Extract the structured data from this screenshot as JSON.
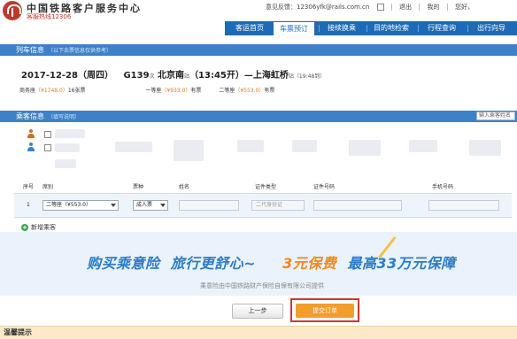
{
  "header": {
    "site_title": "中国铁路客户服务中心",
    "hotline": "客服热线12306",
    "account_label": "意见反馈：",
    "account_email": "12306yfk@rails.com.cn",
    "logout": "退出",
    "my_label": "我的",
    "welcome": "您好，",
    "colors": {
      "brand_red": "#c0392b",
      "nav_blue": "#1d6ab8"
    }
  },
  "nav": {
    "items": [
      "客运首页",
      "车票预订",
      "接续换乘",
      "目的地检索",
      "行程查询",
      "出行向导"
    ],
    "active_index": 1
  },
  "train_info": {
    "bar_title": "列车信息",
    "bar_note": "（以下余票信息仅供参考）",
    "date": "2017-12-28（周四）",
    "train_no": "G139",
    "train_suffix": "次",
    "from": "北京南",
    "from_suffix": "站",
    "depart": "（13:45开）",
    "dash": "—",
    "to": "上海虹桥",
    "to_suffix": "站",
    "arrive": "（19:48到）",
    "seats": [
      {
        "label": "商务座",
        "price": "（¥1748.0）",
        "avail": "16张票"
      },
      {
        "label": "一等座",
        "price": "（¥933.0）",
        "avail": "有票"
      },
      {
        "label": "二等座",
        "price": "（¥553.0）",
        "avail": "有票"
      }
    ]
  },
  "passenger_info": {
    "bar_title": "乘客信息",
    "bar_note": "（填写说明）",
    "search_placeholder": "输入乘客姓名"
  },
  "table": {
    "headers": [
      "序号",
      "席别",
      "票种",
      "姓名",
      "证件类型",
      "证件号码",
      "手机号码"
    ],
    "row": {
      "index": "1",
      "seat": "二等座（¥553.0）",
      "ticket_type": "成人票",
      "id_type": "二代身份证"
    }
  },
  "add_passenger": "新增乘客",
  "banner": {
    "text_1": "购买乘意险",
    "text_2": "旅行更舒心~",
    "text_3": "3元保费",
    "text_4": "最高33万元保障",
    "footnote": "乘意险由中国铁路财产保险自保有限公司提供"
  },
  "actions": {
    "prev": "上一步",
    "submit": "提交订单"
  },
  "footer": {
    "label": "温馨提示"
  }
}
